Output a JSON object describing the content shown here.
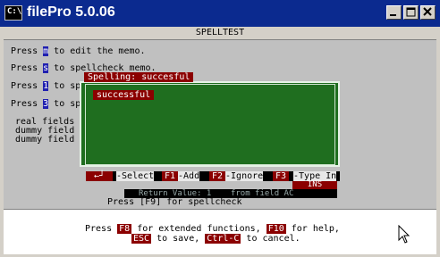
{
  "window": {
    "title": "filePro 5.0.06",
    "icon_label": "C:\\"
  },
  "header": {
    "title": "SPELLTEST"
  },
  "lines": [
    {
      "pre": "Press ",
      "key": "m",
      "post": " to edit the memo."
    },
    {
      "pre": "Press ",
      "key": "s",
      "post": " to spellcheck memo."
    },
    {
      "pre": "Press ",
      "key": "1",
      "post": " to sp"
    },
    {
      "pre": "Press ",
      "key": "3",
      "post": " to sp"
    }
  ],
  "fields": [
    "real fields",
    "dummy field",
    "dummy field"
  ],
  "dialog": {
    "title": "Spelling: succesful",
    "entry": "successful"
  },
  "actions": [
    {
      "key": "←┘",
      "label": "Select"
    },
    {
      "key": "F1",
      "label": "Add"
    },
    {
      "key": "F2",
      "label": "Ignore"
    },
    {
      "key": "F3",
      "label": "Type In"
    }
  ],
  "status": {
    "ins": "INS",
    "return_value": "Return Value: 1    from field AC",
    "f9_hint": "Press [F9] for spellcheck"
  },
  "help": {
    "line1_pre": "Press ",
    "key_f8": "F8",
    "line1_mid": " for extended functions, ",
    "key_f10": "F10",
    "line1_post": " for help,",
    "key_esc": "ESC",
    "line2_mid": " to save, ",
    "key_ctrlc": "Ctrl-C",
    "line2_post": " to cancel."
  }
}
